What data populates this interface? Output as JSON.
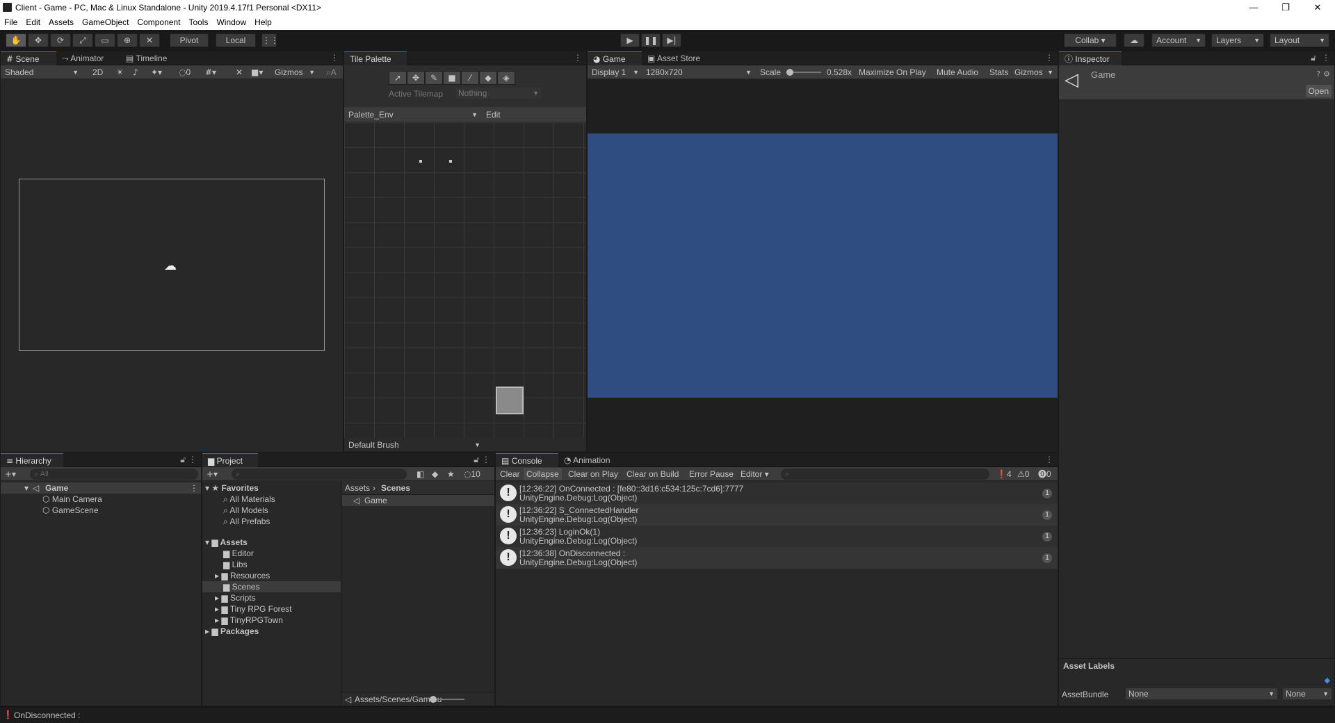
{
  "window": {
    "title": "Client - Game - PC, Mac & Linux Standalone - Unity 2019.4.17f1 Personal <DX11>",
    "controls": [
      "—",
      "❐",
      "✕"
    ]
  },
  "menu": [
    "File",
    "Edit",
    "Assets",
    "GameObject",
    "Component",
    "Tools",
    "Window",
    "Help"
  ],
  "toolbar": {
    "pivot": "Pivot",
    "local": "Local",
    "collab": "Collab ▾",
    "account": "Account",
    "layers": "Layers",
    "layout": "Layout"
  },
  "scene": {
    "tabs": [
      "Scene",
      "Animator",
      "Timeline"
    ],
    "shading": "Shaded",
    "mode2d": "2D",
    "hidden_count": "0",
    "gizmos": "Gizmos",
    "search_prefix": "A"
  },
  "tile_palette": {
    "tab": "Tile Palette",
    "active_tilemap_label": "Active Tilemap",
    "active_tilemap_value": "Nothing",
    "palette": "Palette_Env",
    "edit": "Edit",
    "brush": "Default Brush"
  },
  "game": {
    "tabs": [
      "Game",
      "Asset Store"
    ],
    "display": "Display 1",
    "resolution": "1280x720",
    "scale_label": "Scale",
    "scale_value": "0.528x",
    "maximize": "Maximize On Play",
    "mute": "Mute Audio",
    "stats": "Stats",
    "gizmos": "Gizmos",
    "viewport_color": "#2f4d80"
  },
  "inspector": {
    "tab": "Inspector",
    "object_name": "Game",
    "open": "Open",
    "asset_labels": "Asset Labels",
    "assetbundle_label": "AssetBundle",
    "assetbundle_value": "None",
    "variant_value": "None"
  },
  "hierarchy": {
    "tab": "Hierarchy",
    "search_placeholder": "All",
    "scene": "Game",
    "items": [
      "Main Camera",
      "GameScene"
    ]
  },
  "project": {
    "tab": "Project",
    "hidden_count": "10",
    "favorites": "Favorites",
    "favorite_items": [
      "All Materials",
      "All Models",
      "All Prefabs"
    ],
    "assets": "Assets",
    "asset_folders": [
      "Editor",
      "Libs",
      "Resources",
      "Scenes",
      "Scripts",
      "Tiny RPG Forest",
      "TinyRPGTown"
    ],
    "packages": "Packages",
    "breadcrumb": [
      "Assets",
      "Scenes"
    ],
    "files": [
      "Game"
    ],
    "path": "Assets/Scenes/Game.u"
  },
  "console": {
    "tabs": [
      "Console",
      "Animation"
    ],
    "buttons": [
      "Clear",
      "Collapse",
      "Clear on Play",
      "Clear on Build",
      "Error Pause",
      "Editor ▾"
    ],
    "counts": {
      "log": "4",
      "warn": "0",
      "error": "0"
    },
    "entries": [
      {
        "line1": "[12:36:22] OnConnected : [fe80::3d16:c534:125c:7cd6]:7777",
        "line2": "UnityEngine.Debug:Log(Object)",
        "count": "1"
      },
      {
        "line1": "[12:36:22] S_ConnectedHandler",
        "line2": "UnityEngine.Debug:Log(Object)",
        "count": "1"
      },
      {
        "line1": "[12:36:23] LoginOk(1)",
        "line2": "UnityEngine.Debug:Log(Object)",
        "count": "1"
      },
      {
        "line1": "[12:36:38] OnDisconnected :",
        "line2": "UnityEngine.Debug:Log(Object)",
        "count": "1"
      }
    ]
  },
  "statusbar": {
    "message": "OnDisconnected :"
  }
}
